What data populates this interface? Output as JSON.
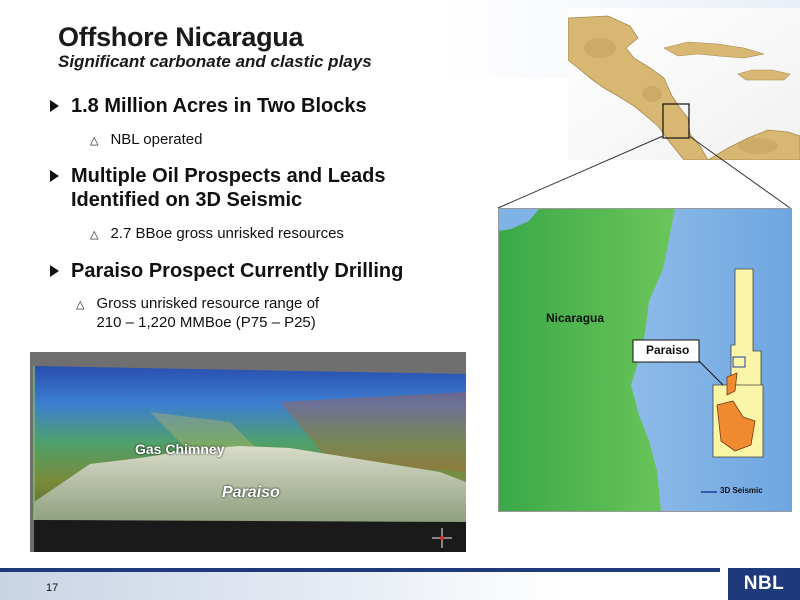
{
  "header": {
    "title": "Offshore Nicaragua",
    "subtitle": "Significant carbonate and clastic plays"
  },
  "bullets": [
    {
      "text": "1.8 Million Acres in Two Blocks",
      "sub": [
        "NBL operated"
      ]
    },
    {
      "text": "Multiple Oil Prospects and Leads",
      "text2": "Identified on 3D Seismic",
      "sub": [
        "2.7 BBoe gross unrisked resources"
      ]
    },
    {
      "text": "Paraiso Prospect Currently Drilling",
      "sub": [
        "Gross unrisked resource range of",
        "210 – 1,220 MMBoe (P75 – P25)"
      ]
    }
  ],
  "seismic_image": {
    "label_gas": "Gas Chimney",
    "label_prospect": "Paraiso"
  },
  "detail_map": {
    "country_label": "Nicaragua",
    "prospect_label": "Paraiso",
    "legend_label": "3D Seismic",
    "colors": {
      "land": "#4cb848",
      "sea": "#7fb3e6",
      "block": "#fbf5a8",
      "prospect": "#f08a30",
      "seismic": "#1f3fa0"
    }
  },
  "footer": {
    "page_number": "17",
    "logo_text": "NBL"
  }
}
